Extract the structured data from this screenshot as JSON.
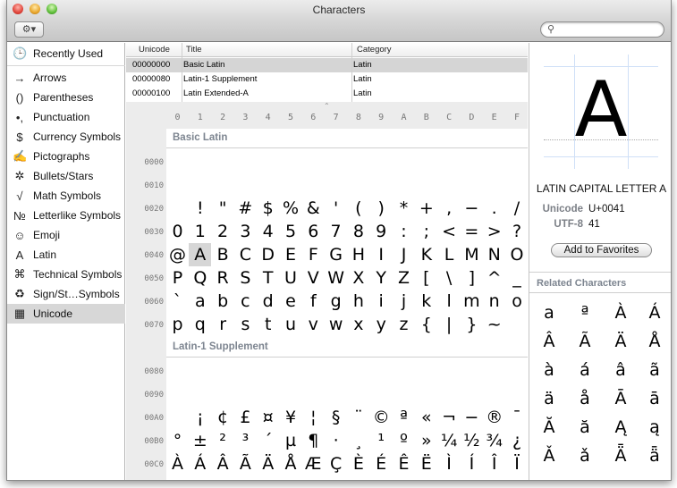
{
  "window": {
    "title": "Characters"
  },
  "toolbar": {
    "action_icon": "⚙▾",
    "search_placeholder": "",
    "search_value": ""
  },
  "sidebar": {
    "items": [
      {
        "label": "Recently Used",
        "icon": "🕒",
        "icon_name": "clock-icon"
      },
      {
        "label": "Arrows",
        "icon": "→",
        "icon_name": "arrow-icon"
      },
      {
        "label": "Parentheses",
        "icon": "()",
        "icon_name": "parentheses-icon"
      },
      {
        "label": "Punctuation",
        "icon": "•,",
        "icon_name": "punctuation-icon"
      },
      {
        "label": "Currency Symbols",
        "icon": "$",
        "icon_name": "dollar-icon"
      },
      {
        "label": "Pictographs",
        "icon": "✍",
        "icon_name": "pictograph-icon"
      },
      {
        "label": "Bullets/Stars",
        "icon": "✲",
        "icon_name": "star-icon"
      },
      {
        "label": "Math Symbols",
        "icon": "√",
        "icon_name": "square-root-icon"
      },
      {
        "label": "Letterlike Symbols",
        "icon": "№",
        "icon_name": "numero-icon"
      },
      {
        "label": "Emoji",
        "icon": "☺",
        "icon_name": "smiley-icon"
      },
      {
        "label": "Latin",
        "icon": "A",
        "icon_name": "latin-a-icon"
      },
      {
        "label": "Technical Symbols",
        "icon": "⌘",
        "icon_name": "command-icon"
      },
      {
        "label": "Sign/St…Symbols",
        "icon": "♻",
        "icon_name": "recycle-icon"
      },
      {
        "label": "Unicode",
        "icon": "▦",
        "icon_name": "grid-icon"
      }
    ],
    "selected": "Unicode"
  },
  "blocks": {
    "headers": {
      "unicode": "Unicode",
      "title": "Title",
      "category": "Category"
    },
    "rows": [
      {
        "unicode": "00000000",
        "title": "Basic Latin",
        "category": "Latin"
      },
      {
        "unicode": "00000080",
        "title": "Latin-1 Supplement",
        "category": "Latin"
      },
      {
        "unicode": "00000100",
        "title": "Latin Extended-A",
        "category": "Latin"
      }
    ],
    "selected_index": 0
  },
  "grid": {
    "column_headers": [
      "0",
      "1",
      "2",
      "3",
      "4",
      "5",
      "6",
      "7",
      "8",
      "9",
      "A",
      "B",
      "C",
      "D",
      "E",
      "F"
    ],
    "sections": [
      {
        "title": "Basic Latin",
        "rows": [
          {
            "label": "0000",
            "chars": [
              "",
              "",
              "",
              "",
              "",
              "",
              "",
              "",
              "",
              "",
              "",
              "",
              "",
              "",
              "",
              ""
            ]
          },
          {
            "label": "0010",
            "chars": [
              "",
              "",
              "",
              "",
              "",
              "",
              "",
              "",
              "",
              "",
              "",
              "",
              "",
              "",
              "",
              ""
            ]
          },
          {
            "label": "0020",
            "chars": [
              " ",
              "!",
              "\"",
              "#",
              "$",
              "%",
              "&",
              "'",
              "(",
              ")",
              "*",
              "+",
              ",",
              "−",
              ".",
              "/"
            ]
          },
          {
            "label": "0030",
            "chars": [
              "0",
              "1",
              "2",
              "3",
              "4",
              "5",
              "6",
              "7",
              "8",
              "9",
              ":",
              ";",
              "<",
              "=",
              ">",
              "?"
            ]
          },
          {
            "label": "0040",
            "chars": [
              "@",
              "A",
              "B",
              "C",
              "D",
              "E",
              "F",
              "G",
              "H",
              "I",
              "J",
              "K",
              "L",
              "M",
              "N",
              "O"
            ]
          },
          {
            "label": "0050",
            "chars": [
              "P",
              "Q",
              "R",
              "S",
              "T",
              "U",
              "V",
              "W",
              "X",
              "Y",
              "Z",
              "[",
              "\\",
              "]",
              "^",
              "_"
            ]
          },
          {
            "label": "0060",
            "chars": [
              "`",
              "a",
              "b",
              "c",
              "d",
              "e",
              "f",
              "g",
              "h",
              "i",
              "j",
              "k",
              "l",
              "m",
              "n",
              "o"
            ]
          },
          {
            "label": "0070",
            "chars": [
              "p",
              "q",
              "r",
              "s",
              "t",
              "u",
              "v",
              "w",
              "x",
              "y",
              "z",
              "{",
              "|",
              "}",
              "~",
              ""
            ]
          }
        ]
      },
      {
        "title": "Latin-1 Supplement",
        "rows": [
          {
            "label": "0080",
            "chars": [
              "",
              "",
              "",
              "",
              "",
              "",
              "",
              "",
              "",
              "",
              "",
              "",
              "",
              "",
              "",
              ""
            ]
          },
          {
            "label": "0090",
            "chars": [
              "",
              "",
              "",
              "",
              "",
              "",
              "",
              "",
              "",
              "",
              "",
              "",
              "",
              "",
              "",
              ""
            ]
          },
          {
            "label": "00A0",
            "chars": [
              " ",
              "¡",
              "¢",
              "£",
              "¤",
              "¥",
              "¦",
              "§",
              "¨",
              "©",
              "ª",
              "«",
              "¬",
              "−",
              "®",
              "¯"
            ]
          },
          {
            "label": "00B0",
            "chars": [
              "°",
              "±",
              "²",
              "³",
              "´",
              "µ",
              "¶",
              "·",
              "¸",
              "¹",
              "º",
              "»",
              "¼",
              "½",
              "¾",
              "¿"
            ]
          },
          {
            "label": "00C0",
            "chars": [
              "À",
              "Á",
              "Â",
              "Ã",
              "Ä",
              "Å",
              "Æ",
              "Ç",
              "È",
              "É",
              "Ê",
              "Ë",
              "Ì",
              "Í",
              "Î",
              "Ï"
            ]
          }
        ]
      }
    ],
    "selected_char": "A"
  },
  "inspector": {
    "glyph": "A",
    "name": "LATIN CAPITAL LETTER A",
    "unicode_label": "Unicode",
    "unicode_value": "U+0041",
    "utf8_label": "UTF-8",
    "utf8_value": "41",
    "favorites_button": "Add to Favorites",
    "related_title": "Related Characters",
    "related": [
      "a",
      "ª",
      "À",
      "Á",
      "Â",
      "Ã",
      "Ä",
      "Å",
      "à",
      "á",
      "â",
      "ã",
      "ä",
      "å",
      "Ā",
      "ā",
      "Ă",
      "ă",
      "Ą",
      "ą",
      "Ǎ",
      "ǎ",
      "Ǟ",
      "ǟ"
    ]
  }
}
